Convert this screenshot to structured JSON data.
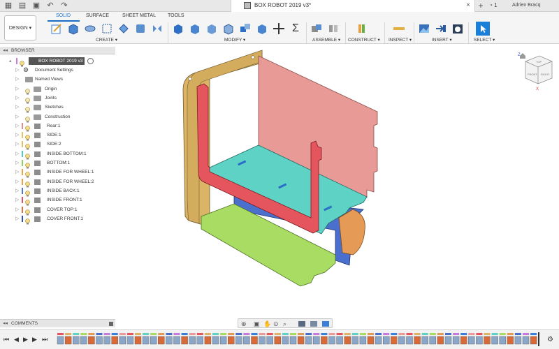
{
  "titlebar": {
    "doc_title": "BOX ROBOT 2019 v3*",
    "job_count": "1",
    "user": "Adrien Bracq",
    "new_tab": "+",
    "close_tab": "×"
  },
  "toolbar": {
    "workspace": "DESIGN",
    "tabs": [
      "SOLID",
      "SURFACE",
      "SHEET METAL",
      "TOOLS"
    ],
    "groups": {
      "create": "CREATE",
      "modify": "MODIFY",
      "assemble": "ASSEMBLE",
      "construct": "CONSTRUCT",
      "inspect": "INSPECT",
      "insert": "INSERT",
      "select": "SELECT"
    },
    "sigma": "Σ"
  },
  "browser": {
    "title": "BROWSER",
    "root": "BOX ROBOT 2019 v3",
    "items": [
      {
        "label": "Document Settings",
        "kind": "gear"
      },
      {
        "label": "Named Views",
        "kind": "folder"
      },
      {
        "label": "Origin",
        "kind": "folder"
      },
      {
        "label": "Joints",
        "kind": "folder"
      },
      {
        "label": "Sketches",
        "kind": "folder"
      },
      {
        "label": "Construction",
        "kind": "folder"
      },
      {
        "label": "Rear:1",
        "kind": "component",
        "color": "#e88a8a"
      },
      {
        "label": "SIDE:1",
        "kind": "component",
        "color": "#e8c060"
      },
      {
        "label": "SIDE:2",
        "kind": "component",
        "color": "#e8c060"
      },
      {
        "label": "INSIDE BOTTOM:1",
        "kind": "component",
        "color": "#4ecdc4"
      },
      {
        "label": "BOTTOM:1",
        "kind": "component",
        "color": "#8fd45a"
      },
      {
        "label": "INSIDE FOR WHEEL:1",
        "kind": "component",
        "color": "#f0a040"
      },
      {
        "label": "INSIDE FOR WHEEL:2",
        "kind": "component",
        "color": "#f0a040"
      },
      {
        "label": "INSIDE BACK:1",
        "kind": "component",
        "color": "#4a78d8"
      },
      {
        "label": "INSIDE FRONT:1",
        "kind": "component",
        "color": "#e0505a"
      },
      {
        "label": "COVER TOP:1",
        "kind": "component",
        "color": "#e07040"
      },
      {
        "label": "COVER FRONT:1",
        "kind": "component",
        "color": "#3050c0"
      }
    ]
  },
  "comments": {
    "title": "COMMENTS"
  },
  "viewcube": {
    "top": "TOP",
    "front": "FRONT",
    "right": "RIGHT",
    "axis_z": "Z",
    "axis_x": "X"
  },
  "timeline": {
    "controls": [
      "⏮",
      "◀",
      "▶",
      "▶",
      "⏭"
    ]
  },
  "colors": {
    "accent": "#1a6fc4",
    "rear": "#e89a96",
    "side": "#dcb465",
    "inside_bottom": "#5fd2c6",
    "bottom": "#a8dc63",
    "inside_front": "#e5555e",
    "inside_back": "#4a6fcc",
    "wheel": "#e59a55"
  }
}
